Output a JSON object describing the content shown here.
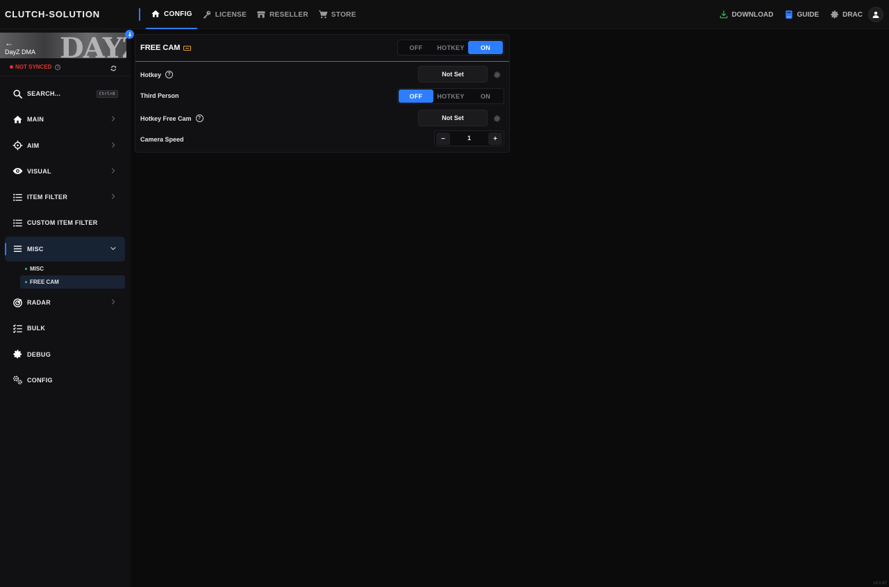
{
  "brand": "CLUTCH-SOLUTION",
  "top_nav": [
    {
      "label": "CONFIG",
      "icon": "home-icon",
      "active": true
    },
    {
      "label": "LICENSE",
      "icon": "key-icon",
      "active": false
    },
    {
      "label": "RESELLER",
      "icon": "store-icon",
      "active": false
    },
    {
      "label": "STORE",
      "icon": "cart-icon",
      "active": false
    }
  ],
  "right_nav": {
    "download": "DOWNLOAD",
    "guide": "GUIDE",
    "user": "DRAC"
  },
  "game": {
    "name": "DayZ DMA",
    "logo_text": "DAYZ",
    "back_glyph": "←",
    "sync_status": "NOT SYNCED",
    "info_glyph": "i"
  },
  "search": {
    "label": "SEARCH...",
    "shortcut": "Ctrl+K"
  },
  "menu": {
    "main": "MAIN",
    "aim": "AIM",
    "visual": "VISUAL",
    "item_filter": "ITEM FILTER",
    "custom_item_filter": "CUSTOM ITEM FILTER",
    "misc": "MISC",
    "misc_sub": [
      "MISC",
      "FREE CAM"
    ],
    "radar": "RADAR",
    "bulk": "BULK",
    "debug": "DEBUG",
    "config": "CONFIG"
  },
  "panel": {
    "title": "FREE CAM",
    "mode_options": [
      "OFF",
      "HOTKEY",
      "ON"
    ],
    "mode_selected": "ON",
    "rows": {
      "hotkey_label": "Hotkey",
      "hotkey_value": "Not Set",
      "third_person_label": "Third Person",
      "third_person_options": [
        "OFF",
        "HOTKEY",
        "ON"
      ],
      "third_person_selected": "OFF",
      "hotkey_free_cam_label": "Hotkey Free Cam",
      "hotkey_free_cam_value": "Not Set",
      "camera_speed_label": "Camera Speed",
      "camera_speed_value": "1",
      "minus": "−",
      "plus": "+",
      "help_glyph": "?"
    }
  },
  "version": "v3.0.87",
  "colors": {
    "accent": "#2d7dff",
    "sync_error": "#e0362f",
    "download_green": "#3cb860",
    "submenu_dot": "#27c19a",
    "keyboard_icon": "#e0a227"
  }
}
